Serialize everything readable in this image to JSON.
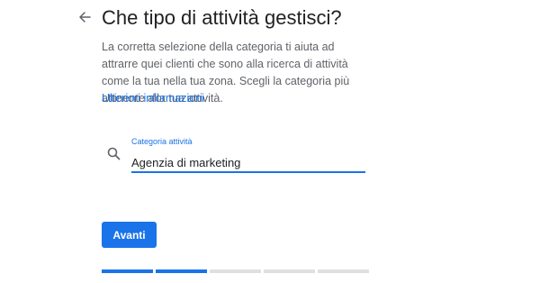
{
  "header": {
    "back_icon": "arrow-back-icon",
    "title": "Che tipo di attività gestisci?"
  },
  "intro": {
    "description": "La corretta selezione della categoria ti aiuta ad attrarre quei clienti che sono alla ricerca di attività come la tua nella tua zona. Scegli la categoria più attinente alla tua attività.",
    "learn_more": "Ulteriori informazioni"
  },
  "category_field": {
    "icon": "search-icon",
    "label": "Categoria attività",
    "value": "Agenzia di marketing"
  },
  "actions": {
    "next_label": "Avanti"
  },
  "progress": {
    "total_steps": 5,
    "completed_steps": 2
  },
  "colors": {
    "accent": "#1a73e8",
    "track": "#e0e0e0",
    "text_primary": "#202124",
    "text_secondary": "#5f6368"
  }
}
